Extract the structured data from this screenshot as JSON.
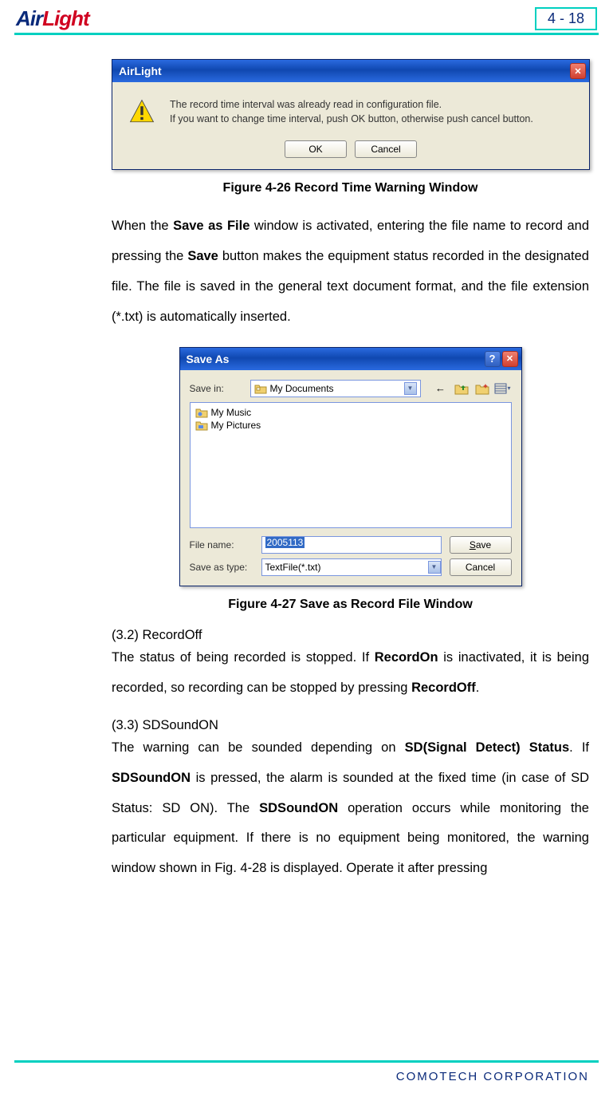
{
  "header": {
    "logo_part1": "Air",
    "logo_part2": "Light",
    "page_number": "4 - 18"
  },
  "dialog1": {
    "title": "AirLight",
    "line1": "The record time interval was already read in configuration file.",
    "line2": "If you want to change time interval, push OK button, otherwise push cancel button.",
    "ok": "OK",
    "cancel": "Cancel"
  },
  "caption1": "Figure 4-26 Record Time Warning Window",
  "para1_a": "When the ",
  "para1_b": "Save as File",
  "para1_c": " window is activated, entering the file name to record and pressing the ",
  "para1_d": "Save",
  "para1_e": " button makes the equipment status recorded in the designated file. The file is saved in the general text document format, and the file extension (*.txt) is automatically inserted.",
  "dialog2": {
    "title": "Save As",
    "save_in_label": "Save in:",
    "save_in_value": "My Documents",
    "items": {
      "music": "My Music",
      "pictures": "My Pictures"
    },
    "filename_label": "File name:",
    "filename_value": "2005113",
    "savetype_label": "Save as type:",
    "savetype_value": "TextFile(*.txt)",
    "save_btn_pre": "S",
    "save_btn_post": "ave",
    "cancel_btn": "Cancel"
  },
  "caption2": "Figure 4-27 Save as Record File Window",
  "sec32_head": "(3.2) RecordOff",
  "sec32_a": "The status of being recorded is stopped. If ",
  "sec32_b": "RecordOn",
  "sec32_c": " is inactivated, it is being recorded, so recording can be stopped by pressing ",
  "sec32_d": "RecordOff",
  "sec32_e": ".",
  "sec33_head": "(3.3) SDSoundON",
  "sec33_a": "The warning can be sounded depending on ",
  "sec33_b": "SD(Signal Detect) Status",
  "sec33_c": ". If ",
  "sec33_d": "SDSoundON",
  "sec33_e": " is pressed, the alarm is sounded at the fixed time (in case of SD Status: SD ON). The ",
  "sec33_f": "SDSoundON",
  "sec33_g": " operation occurs while monitoring the particular equipment. If there is no equipment being monitored, the warning window shown in Fig. 4-28 is displayed. Operate it after pressing",
  "footer": "COMOTECH CORPORATION"
}
